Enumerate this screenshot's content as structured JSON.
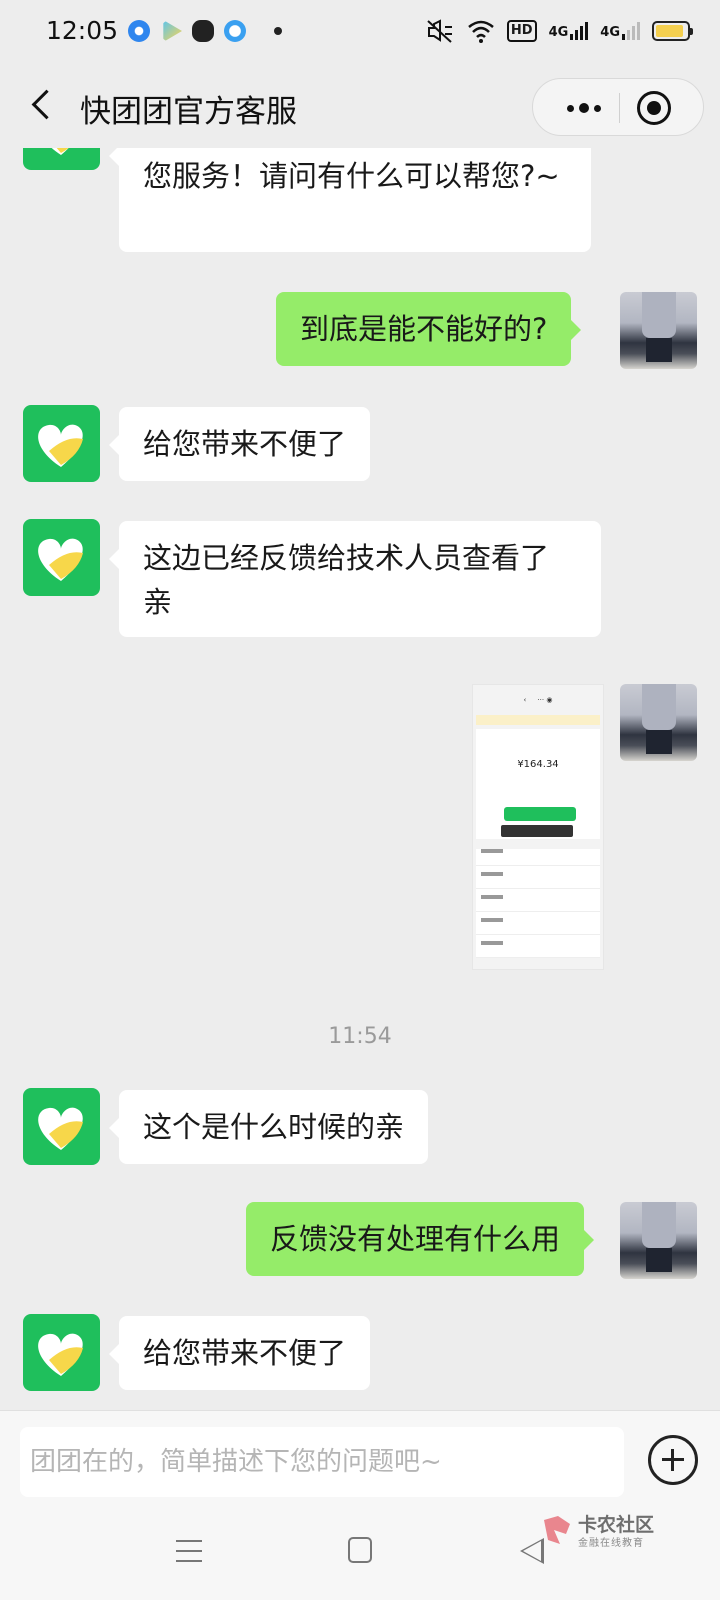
{
  "status_bar": {
    "time": "12:05",
    "hd_label": "HD",
    "signal_1": "4G",
    "signal_2": "4G",
    "battery_level": 0.9
  },
  "header": {
    "title": "快团团官方客服"
  },
  "chat": {
    "messages": [
      {
        "side": "left",
        "text": "您服务！请问有什么可以帮您?~"
      },
      {
        "side": "right",
        "text": "到底是能不能好的?"
      },
      {
        "side": "left",
        "text": "给您带来不便了"
      },
      {
        "side": "left",
        "text": "这边已经反馈给技术人员查看了亲"
      },
      {
        "side": "right",
        "type": "image",
        "amount": "¥164.34"
      },
      {
        "side": "left",
        "text": "这个是什么时候的亲"
      },
      {
        "side": "right",
        "text": "反馈没有处理有什么用"
      },
      {
        "side": "left",
        "text": "给您带来不便了"
      }
    ],
    "timestamp": "11:54"
  },
  "composer": {
    "placeholder": "团团在的，简单描述下您的问题吧~"
  },
  "watermark": {
    "name": "卡农社区",
    "tagline": "金融在线教育"
  },
  "colors": {
    "bot_avatar": "#1fbf5c",
    "right_bubble": "#95ec69",
    "background": "#ededed"
  }
}
